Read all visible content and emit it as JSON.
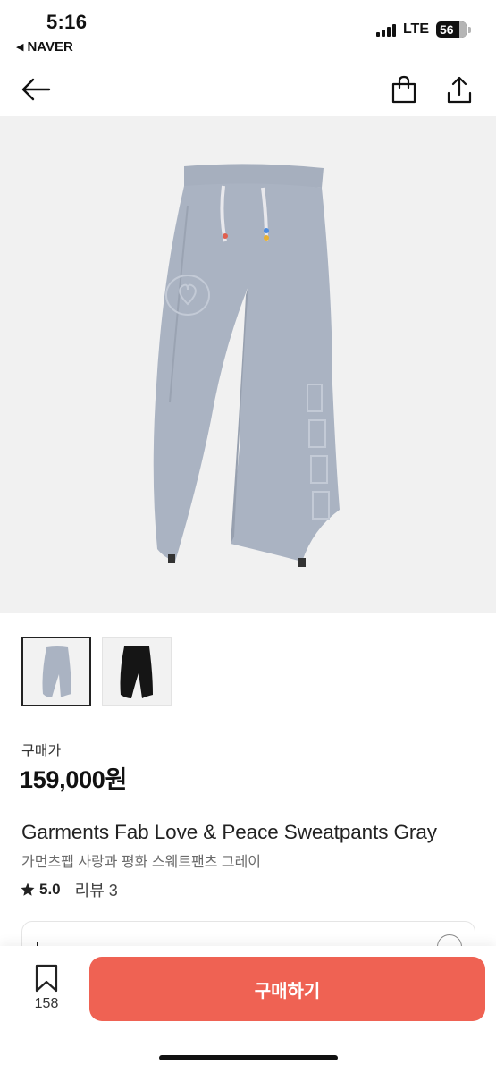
{
  "status_bar": {
    "time": "5:16",
    "back_app": "NAVER",
    "network": "LTE",
    "battery": "56"
  },
  "nav": {
    "back_icon": "arrow-left-icon",
    "bag_icon": "shopping-bag-icon",
    "share_icon": "share-icon"
  },
  "product": {
    "price_label": "구매가",
    "price": "159,000원",
    "title_en": "Garments Fab Love & Peace Sweatpants Gray",
    "title_ko": "가먼츠팹 사랑과 평화 스웨트팬츠 그레이",
    "rating": "5.0",
    "review_link": "리뷰 3",
    "thumbnails": [
      {
        "color": "gray",
        "selected": true
      },
      {
        "color": "black",
        "selected": false
      }
    ]
  },
  "bottom_bar": {
    "bookmark_count": "158",
    "buy_label": "구매하기"
  },
  "colors": {
    "accent": "#ef6253",
    "hero_bg": "#f1f1f1",
    "pants_gray": "#aab3c2",
    "pants_black": "#151515"
  }
}
